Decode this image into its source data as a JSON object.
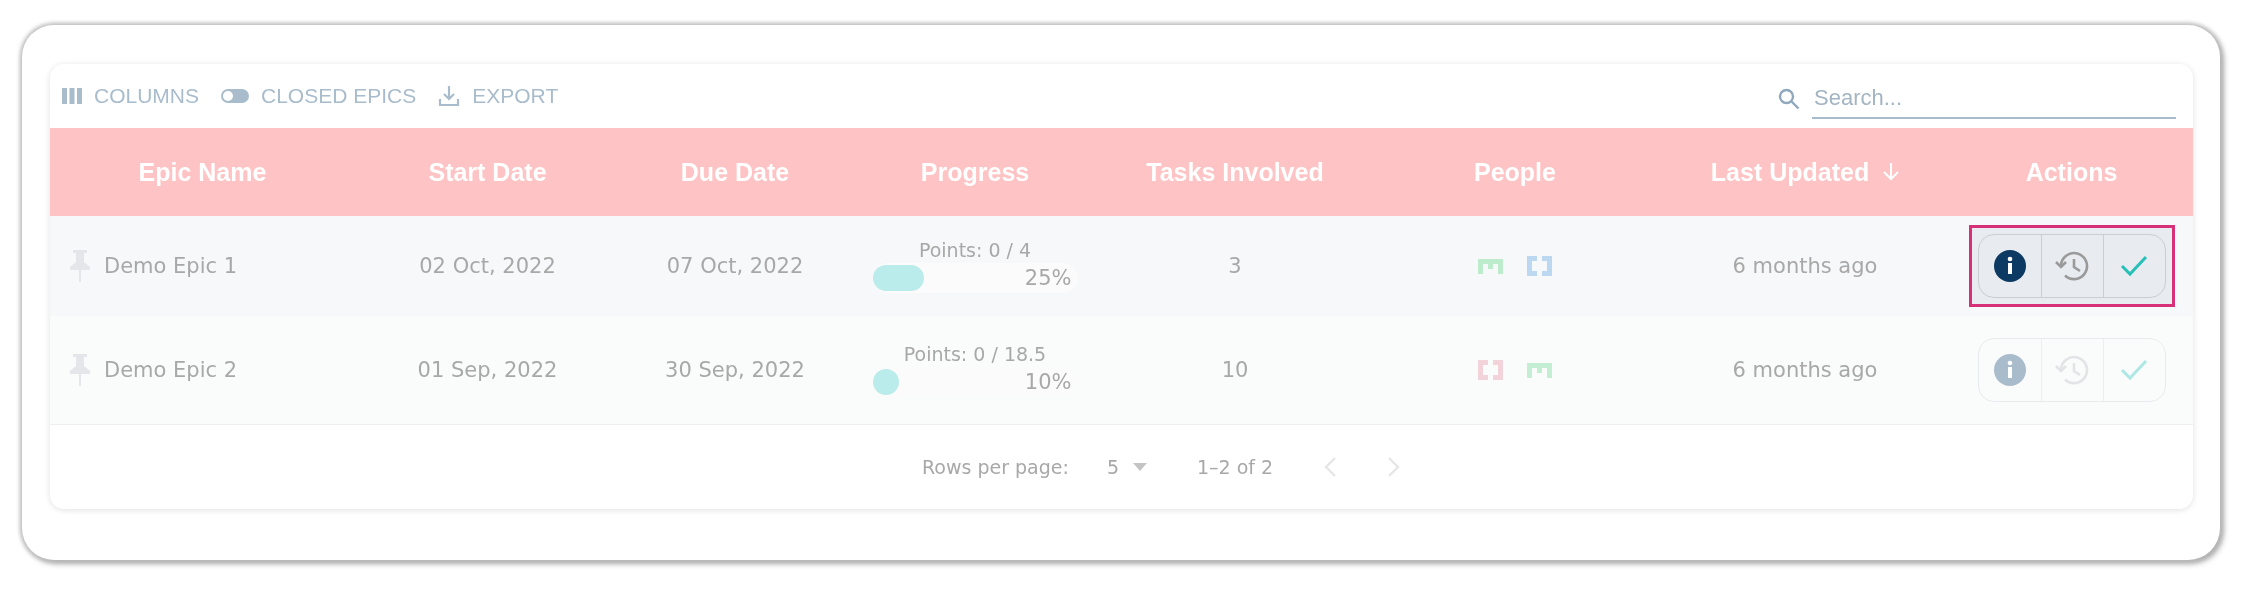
{
  "toolbar": {
    "buttons": [
      {
        "kind": "columns",
        "label": "COLUMNS"
      },
      {
        "kind": "toggle",
        "label": "CLOSED EPICS",
        "on": false
      },
      {
        "kind": "export",
        "label": "EXPORT"
      }
    ],
    "search": {
      "placeholder": "Search..."
    }
  },
  "table": {
    "columns": [
      {
        "label": "Epic Name",
        "sorted": false
      },
      {
        "label": "Start Date",
        "sorted": false
      },
      {
        "label": "Due Date",
        "sorted": false
      },
      {
        "label": "Progress",
        "sorted": false
      },
      {
        "label": "Tasks Involved",
        "sorted": false
      },
      {
        "label": "People",
        "sorted": false
      },
      {
        "label": "Last Updated",
        "sorted": true
      },
      {
        "label": "Actions",
        "sorted": false
      }
    ],
    "rows": [
      {
        "highlighted": true,
        "name": "Demo Epic 1",
        "start": "02 Oct, 2022",
        "due": "07 Oct, 2022",
        "points": "Points: 0 / 4",
        "level": 0.25,
        "percent": "25%",
        "tasks": "3",
        "people": [
          {
            "color": "#bdeccd"
          },
          {
            "color": "#bcd8f0"
          }
        ],
        "updated": "6 months ago"
      },
      {
        "highlighted": false,
        "name": "Demo Epic 2",
        "start": "01 Sep, 2022",
        "due": "30 Sep, 2022",
        "points": "Points: 0 / 18.5",
        "level": 0.1,
        "percent": "10%",
        "tasks": "10",
        "people": [
          {
            "color": "#f2d3d9"
          },
          {
            "color": "#c4eed3"
          }
        ],
        "updated": "6 months ago"
      }
    ]
  },
  "pagination": {
    "label": "Rows per page:",
    "rows_per_page": "5",
    "range": "1–2 of 2",
    "prev_disabled": true,
    "next_disabled": true
  }
}
